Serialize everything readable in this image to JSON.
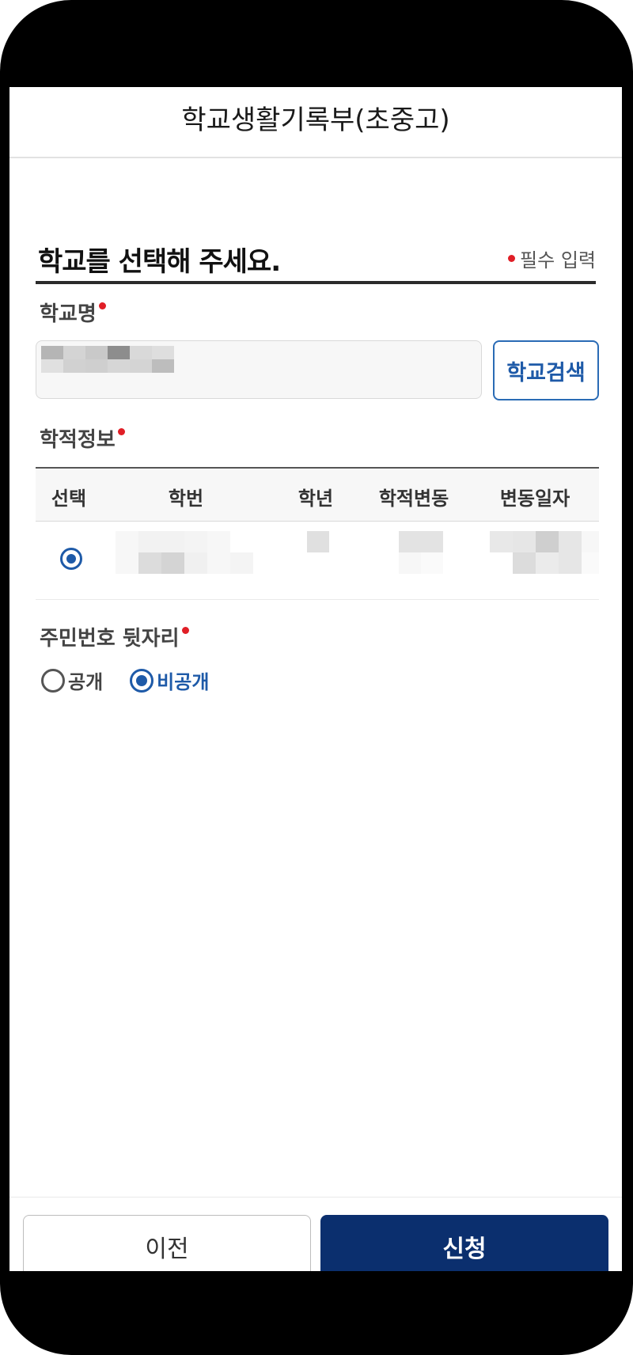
{
  "header": {
    "title": "학교생활기록부(초중고)"
  },
  "section": {
    "title": "학교를 선택해 주세요.",
    "required_note": "필수 입력"
  },
  "school_field": {
    "label": "학교명",
    "search_button": "학교검색"
  },
  "enrollment": {
    "label": "학적정보",
    "columns": [
      "선택",
      "학번",
      "학년",
      "학적변동",
      "변동일자"
    ]
  },
  "resident_number": {
    "label": "주민번호 뒷자리",
    "options": [
      "공개",
      "비공개"
    ],
    "selected": "비공개"
  },
  "footer": {
    "prev_label": "이전",
    "apply_label": "신청"
  },
  "colors": {
    "primary": "#0b2f6e",
    "accent": "#1e5aa8",
    "required": "#e01e26"
  }
}
